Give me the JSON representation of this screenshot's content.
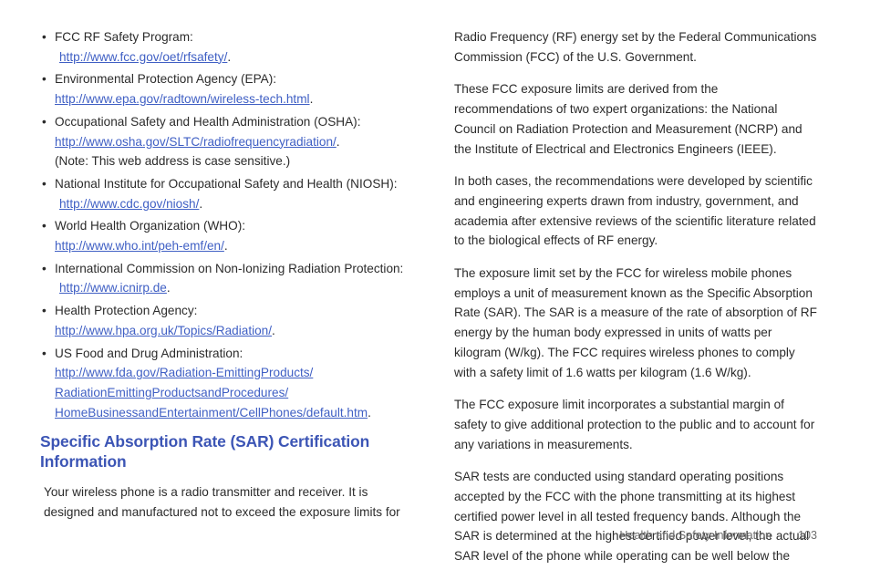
{
  "page": {
    "background": "#ffffff",
    "text_color": "#2b2b2b",
    "heading_color": "#3c55b5",
    "link_color": "#3f5fc4",
    "footer_color": "#6e6e6e"
  },
  "left_column": {
    "resources": [
      {
        "bullet": "•",
        "label": "FCC RF Safety Program:",
        "url_lines": [
          "http://www.fcc.gov/oet/rfsafety/"
        ],
        "url_indented": true,
        "trailing_period": ".",
        "note": ""
      },
      {
        "bullet": "•",
        "label": "Environmental Protection Agency (EPA):",
        "url_lines": [
          "http://www.epa.gov/radtown/wireless-tech.html"
        ],
        "url_indented": false,
        "trailing_period": ".",
        "note": ""
      },
      {
        "bullet": "•",
        "label": "Occupational Safety and Health Administration (OSHA):",
        "url_lines": [
          "http://www.osha.gov/SLTC/radiofrequencyradiation/"
        ],
        "url_indented": false,
        "trailing_period": ".",
        "note": "(Note: This web address is case sensitive.)"
      },
      {
        "bullet": "•",
        "label": "National Institute for Occupational Safety and Health (NIOSH):",
        "url_lines": [
          "http://www.cdc.gov/niosh/"
        ],
        "url_indented": true,
        "trailing_period": ".",
        "note": ""
      },
      {
        "bullet": "•",
        "label": "World Health Organization (WHO):",
        "url_lines": [
          "http://www.who.int/peh-emf/en/"
        ],
        "url_indented": false,
        "trailing_period": ".",
        "note": ""
      },
      {
        "bullet": "•",
        "label": "International Commission on Non-Ionizing Radiation Protection:",
        "url_lines": [
          "http://www.icnirp.de"
        ],
        "url_indented": true,
        "trailing_period": ".",
        "note": ""
      },
      {
        "bullet": "•",
        "label": "Health Protection Agency:",
        "url_lines": [
          "http://www.hpa.org.uk/Topics/Radiation/"
        ],
        "url_indented": false,
        "trailing_period": ".",
        "note": ""
      },
      {
        "bullet": "•",
        "label": "US Food and Drug Administration:",
        "url_lines": [
          "http://www.fda.gov/Radiation-EmittingProducts/",
          "RadiationEmittingProductsandProcedures/",
          "HomeBusinessandEntertainment/CellPhones/default.htm"
        ],
        "url_indented": false,
        "trailing_period": ".",
        "note": ""
      }
    ],
    "section_heading": "Specific Absorption Rate (SAR) Certification Information",
    "intro_paragraph": "Your wireless phone is a radio transmitter and receiver. It is designed and manufactured not to exceed the exposure limits for"
  },
  "right_column": {
    "paragraphs": [
      "Radio Frequency (RF) energy set by the Federal Communications Commission (FCC) of the U.S. Government.",
      "These FCC exposure limits are derived from the recommendations of two expert organizations: the National Council on Radiation Protection and Measurement (NCRP) and the Institute of Electrical and Electronics Engineers (IEEE).",
      "In both cases, the recommendations were developed by scientific and engineering experts drawn from industry, government, and academia after extensive reviews of the scientific literature related to the biological effects of RF energy.",
      "The exposure limit set by the FCC for wireless mobile phones employs a unit of measurement known as the Specific Absorption Rate (SAR). The SAR is a measure of the rate of absorption of RF energy by the human body expressed in units of watts per kilogram (W/kg). The FCC requires wireless phones to comply with a safety limit of 1.6 watts per kilogram (1.6 W/kg).",
      "The FCC exposure limit incorporates a substantial margin of safety to give additional protection to the public and to account for any variations in measurements.",
      "SAR tests are conducted using standard operating positions accepted by the FCC with the phone transmitting at its highest certified power level in all tested frequency bands. Although the SAR is determined at the highest certified power level, the actual SAR level of the phone while operating can be well below the"
    ]
  },
  "footer": {
    "title": "Health and Safety Information",
    "page_number": "103"
  }
}
